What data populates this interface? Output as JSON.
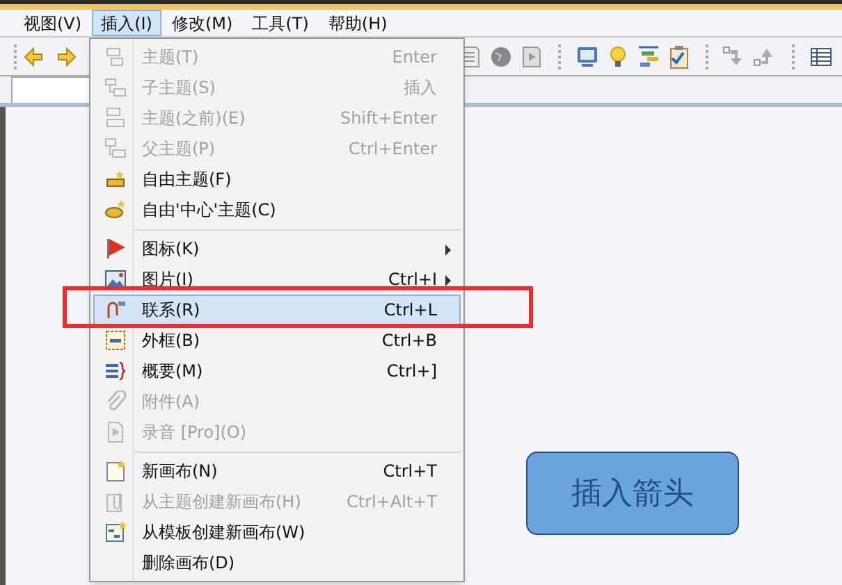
{
  "menubar": [
    {
      "label": "视图(V)",
      "selected": false
    },
    {
      "label": "插入(I)",
      "selected": true
    },
    {
      "label": "修改(M)",
      "selected": false
    },
    {
      "label": "工具(T)",
      "selected": false
    },
    {
      "label": "帮助(H)",
      "selected": false
    }
  ],
  "menu": {
    "groups": [
      [
        {
          "label": "主题(T)",
          "shortcut": "Enter",
          "disabled": true,
          "submenu": false,
          "selected": false
        },
        {
          "label": "子主题(S)",
          "shortcut": "插入",
          "disabled": true,
          "submenu": false,
          "selected": false
        },
        {
          "label": "主题(之前)(E)",
          "shortcut": "Shift+Enter",
          "disabled": true,
          "submenu": false,
          "selected": false
        },
        {
          "label": "父主题(P)",
          "shortcut": "Ctrl+Enter",
          "disabled": true,
          "submenu": false,
          "selected": false
        },
        {
          "label": "自由主题(F)",
          "disabled": false,
          "submenu": false,
          "selected": false
        },
        {
          "label": "自由'中心'主题(C)",
          "disabled": false,
          "submenu": false,
          "selected": false
        }
      ],
      [
        {
          "label": "图标(K)",
          "disabled": false,
          "submenu": true,
          "selected": false
        },
        {
          "label": "图片(I)",
          "shortcut": "Ctrl+I",
          "disabled": false,
          "submenu": true,
          "selected": false
        },
        {
          "label": "联系(R)",
          "shortcut": "Ctrl+L",
          "disabled": false,
          "submenu": false,
          "selected": true
        },
        {
          "label": "外框(B)",
          "shortcut": "Ctrl+B",
          "disabled": false,
          "submenu": false,
          "selected": false
        },
        {
          "label": "概要(M)",
          "shortcut": "Ctrl+]",
          "disabled": false,
          "submenu": false,
          "selected": false
        },
        {
          "label": "附件(A)",
          "disabled": true,
          "submenu": false,
          "selected": false
        },
        {
          "label": "录音 [Pro](O)",
          "disabled": true,
          "submenu": false,
          "selected": false
        }
      ],
      [
        {
          "label": "新画布(N)",
          "shortcut": "Ctrl+T",
          "disabled": false,
          "submenu": false,
          "selected": false
        },
        {
          "label": "从主题创建新画布(H)",
          "shortcut": "Ctrl+Alt+T",
          "disabled": true,
          "submenu": false,
          "selected": false
        },
        {
          "label": "从模板创建新画布(W)",
          "disabled": false,
          "submenu": false,
          "selected": false
        },
        {
          "label": "删除画布(D)",
          "disabled": false,
          "submenu": false,
          "selected": false
        }
      ]
    ]
  },
  "canvas": {
    "topic": "插入箭头"
  }
}
